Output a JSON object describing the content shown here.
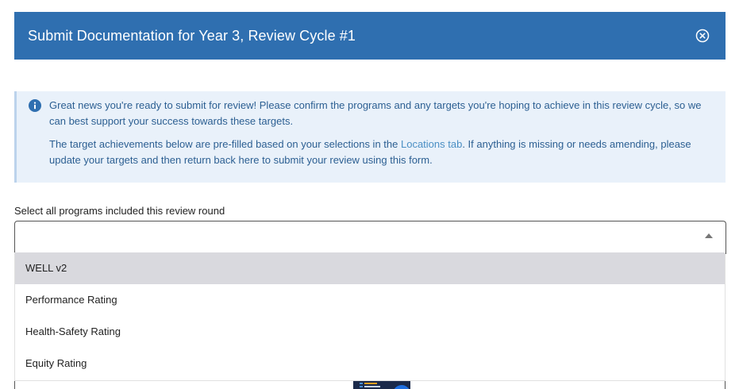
{
  "modal": {
    "title": "Submit Documentation for Year 3, Review Cycle #1",
    "close_icon": "close-circle-icon"
  },
  "info": {
    "icon": "info-icon",
    "paragraph1": "Great news you're ready to submit for review! Please confirm the programs and any targets you're hoping to achieve in this review cycle, so we can best support your success towards these targets.",
    "paragraph2_before": "The target achievements below are pre-filled based on your selections in the ",
    "paragraph2_link": "Locations tab",
    "paragraph2_after": ". If anything is missing or needs amending, please update your targets and then return back here to submit your review using this form."
  },
  "programs_field": {
    "label": "Select all programs included this review round",
    "value": "",
    "options": [
      "WELL v2",
      "Performance Rating",
      "Health-Safety Rating",
      "Equity Rating"
    ],
    "highlighted_option": "WELL v2"
  },
  "colors": {
    "header_bg": "#2f6fb0",
    "info_bg": "#e9f1fa",
    "info_text": "#2c5f92",
    "highlight_bg": "#d9d9de"
  }
}
